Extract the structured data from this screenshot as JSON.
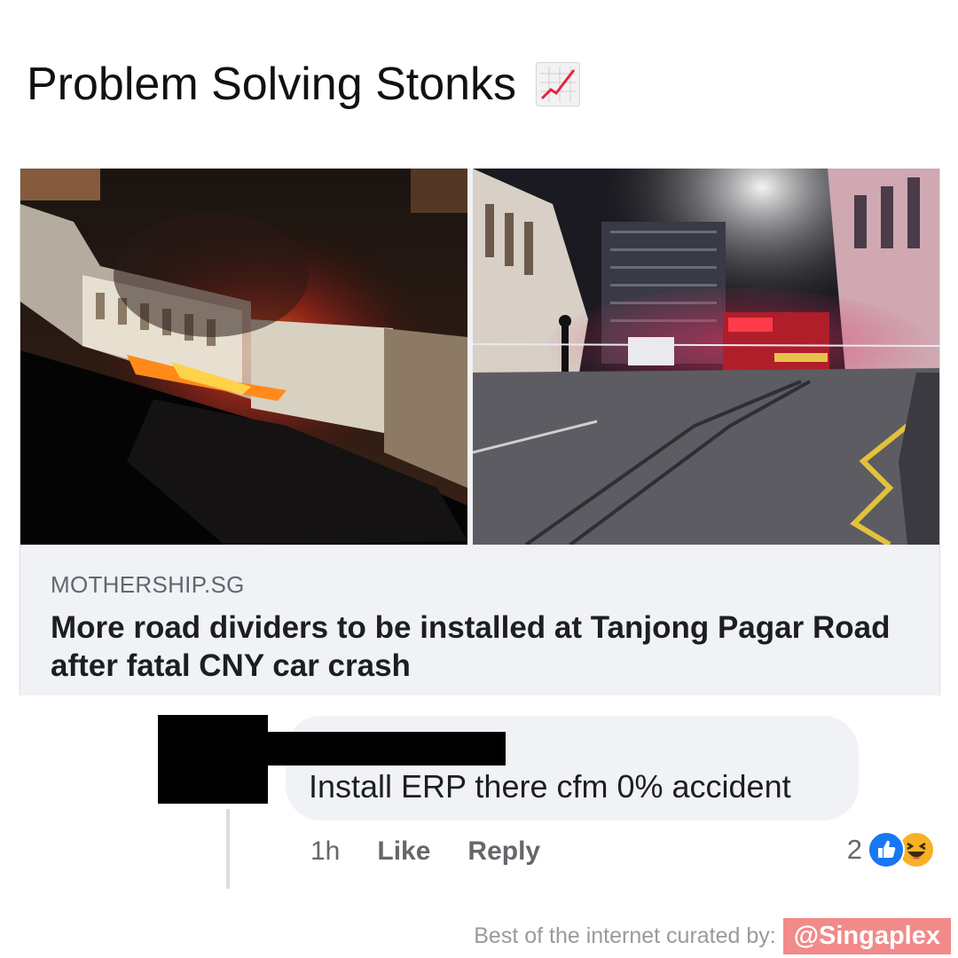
{
  "meme": {
    "title": "Problem Solving Stonks",
    "title_emoji": "chart-increasing-icon"
  },
  "link_preview": {
    "domain": "MOTHERSHIP.SG",
    "headline": "More road dividers to be installed at Tanjong Pagar Road after fatal CNY car crash",
    "images": [
      "fire-at-shophouse-photo",
      "road-crash-scene-photo"
    ]
  },
  "comment": {
    "text": "Install ERP there cfm 0% accident",
    "time": "1h",
    "like_label": "Like",
    "reply_label": "Reply",
    "reaction_count": "2",
    "reaction_icons": [
      "like-icon",
      "haha-icon"
    ]
  },
  "footer": {
    "curated_label": "Best of the internet curated by:",
    "handle": "@Singaplex"
  },
  "colors": {
    "link_card_bg": "#f0f2f5",
    "like_blue": "#1877f2",
    "haha_yellow": "#f7b125",
    "handle_bg": "#f28a8a"
  }
}
